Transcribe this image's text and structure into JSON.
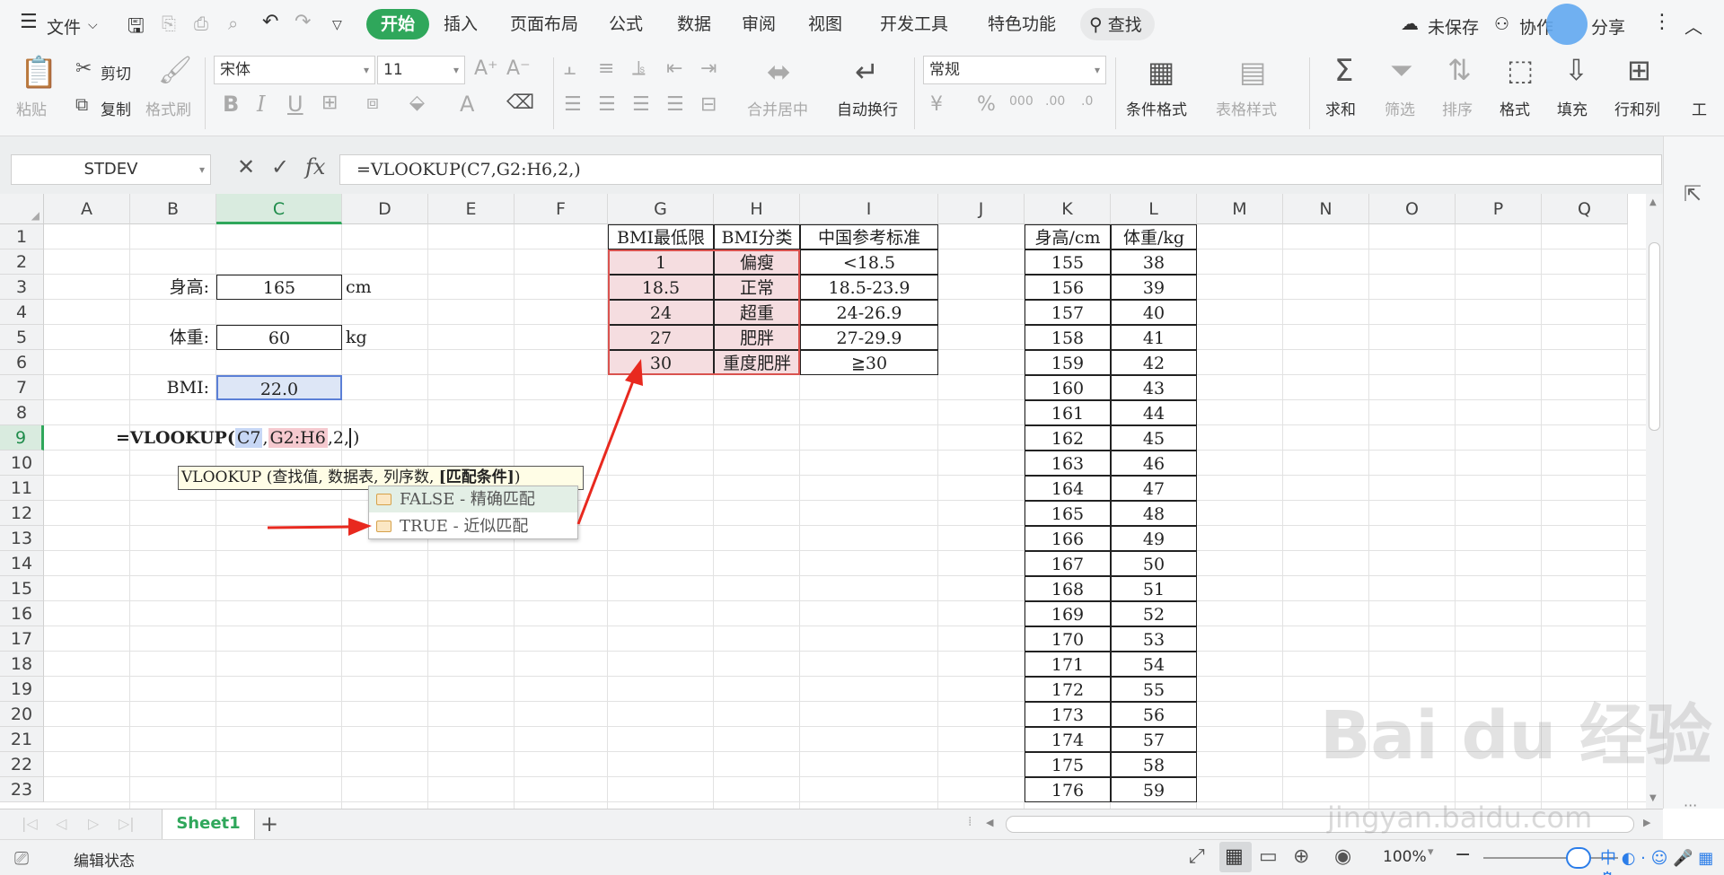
{
  "menu": {
    "file_label": "文件",
    "tabs": [
      "开始",
      "插入",
      "页面布局",
      "公式",
      "数据",
      "审阅",
      "视图",
      "开发工具",
      "特色功能"
    ],
    "active_tab": "开始",
    "search_label": "查找",
    "unsaved_label": "未保存",
    "collab_label": "协作",
    "share_label": "分享"
  },
  "ribbon": {
    "paste": "粘贴",
    "cut": "剪切",
    "copy": "复制",
    "format_painter": "格式刷",
    "font_name": "宋体",
    "font_size": "11",
    "merge_center": "合并居中",
    "wrap_text": "自动换行",
    "number_format": "常规",
    "conditional_format": "条件格式",
    "table_style": "表格样式",
    "sum": "求和",
    "filter": "筛选",
    "sort": "排序",
    "format": "格式",
    "fill": "填充",
    "row_col": "行和列",
    "work": "工"
  },
  "formula_bar": {
    "name_box": "STDEV",
    "formula": "=VLOOKUP(C7,G2:H6,2,)"
  },
  "columns": [
    "A",
    "B",
    "C",
    "D",
    "E",
    "F",
    "G",
    "H",
    "I",
    "J",
    "K",
    "L",
    "M",
    "N",
    "O",
    "P",
    "Q"
  ],
  "rows": [
    "1",
    "2",
    "3",
    "4",
    "5",
    "6",
    "7",
    "8",
    "9",
    "10",
    "11",
    "12",
    "13",
    "14",
    "15",
    "16",
    "17",
    "18",
    "19",
    "20",
    "21",
    "22",
    "23"
  ],
  "inputs": {
    "height_label": "身高:",
    "height_value": "165",
    "height_unit": "cm",
    "weight_label": "体重:",
    "weight_value": "60",
    "weight_unit": "kg",
    "bmi_label": "BMI:",
    "bmi_value": "22.0"
  },
  "edit": {
    "prefix": "=VLOOKUP(",
    "ref1": "C7",
    "sep1": ",",
    "ref2": "G2:H6",
    "rest": ",2,",
    "close": ")"
  },
  "bmi_table": {
    "headers": [
      "BMI最低限",
      "BMI分类",
      "中国参考标准"
    ],
    "rows": [
      [
        "1",
        "偏瘦",
        "<18.5"
      ],
      [
        "18.5",
        "正常",
        "18.5-23.9"
      ],
      [
        "24",
        "超重",
        "24-26.9"
      ],
      [
        "27",
        "肥胖",
        "27-29.9"
      ],
      [
        "30",
        "重度肥胖",
        "≧30"
      ]
    ]
  },
  "hw_table": {
    "headers": [
      "身高/cm",
      "体重/kg"
    ],
    "rows": [
      [
        "155",
        "38"
      ],
      [
        "156",
        "39"
      ],
      [
        "157",
        "40"
      ],
      [
        "158",
        "41"
      ],
      [
        "159",
        "42"
      ],
      [
        "160",
        "43"
      ],
      [
        "161",
        "44"
      ],
      [
        "162",
        "45"
      ],
      [
        "163",
        "46"
      ],
      [
        "164",
        "47"
      ],
      [
        "165",
        "48"
      ],
      [
        "166",
        "49"
      ],
      [
        "167",
        "50"
      ],
      [
        "168",
        "51"
      ],
      [
        "169",
        "52"
      ],
      [
        "170",
        "53"
      ],
      [
        "171",
        "54"
      ],
      [
        "172",
        "55"
      ],
      [
        "173",
        "56"
      ],
      [
        "174",
        "57"
      ],
      [
        "175",
        "58"
      ],
      [
        "176",
        "59"
      ]
    ]
  },
  "tooltip": {
    "text": "VLOOKUP (查找值, 数据表, 列序数, ",
    "bold": "[匹配条件]",
    "end": ")"
  },
  "autocomplete": [
    "FALSE - 精确匹配",
    "TRUE - 近似匹配"
  ],
  "sheet_tab": "Sheet1",
  "status": {
    "mode": "编辑状态",
    "zoom": "100%"
  },
  "colors": {
    "accent": "#2fa75b",
    "arrow": "#e8291f",
    "pink_fill": "#f5dde0"
  }
}
